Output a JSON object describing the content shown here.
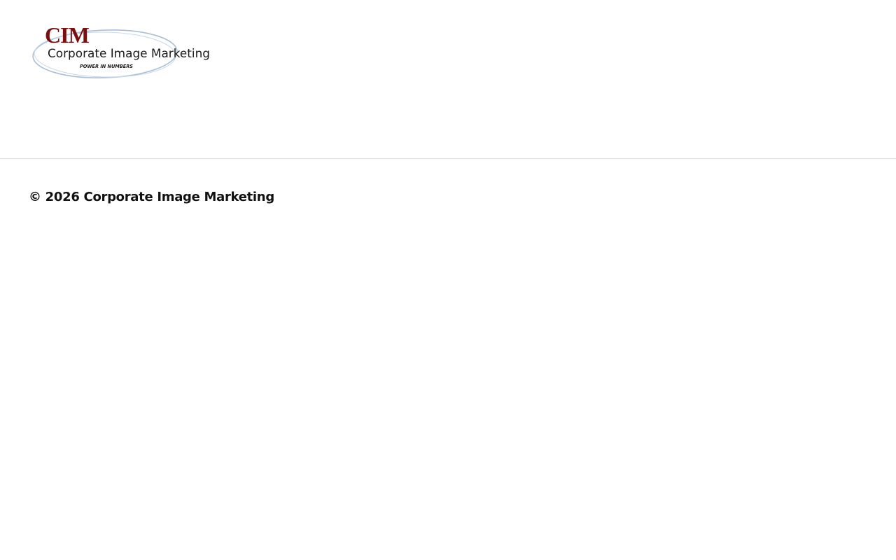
{
  "header": {
    "logo": {
      "monogram": "CIM",
      "name": "Corporate Image Marketing",
      "tagline": "POWER IN NUMBERS",
      "monogram_color": "#7a0f0f",
      "ellipse_color": "#a9bfd6",
      "text_color": "#1a1a1a"
    }
  },
  "footer": {
    "copyright": "© 2026 Corporate Image Marketing"
  }
}
